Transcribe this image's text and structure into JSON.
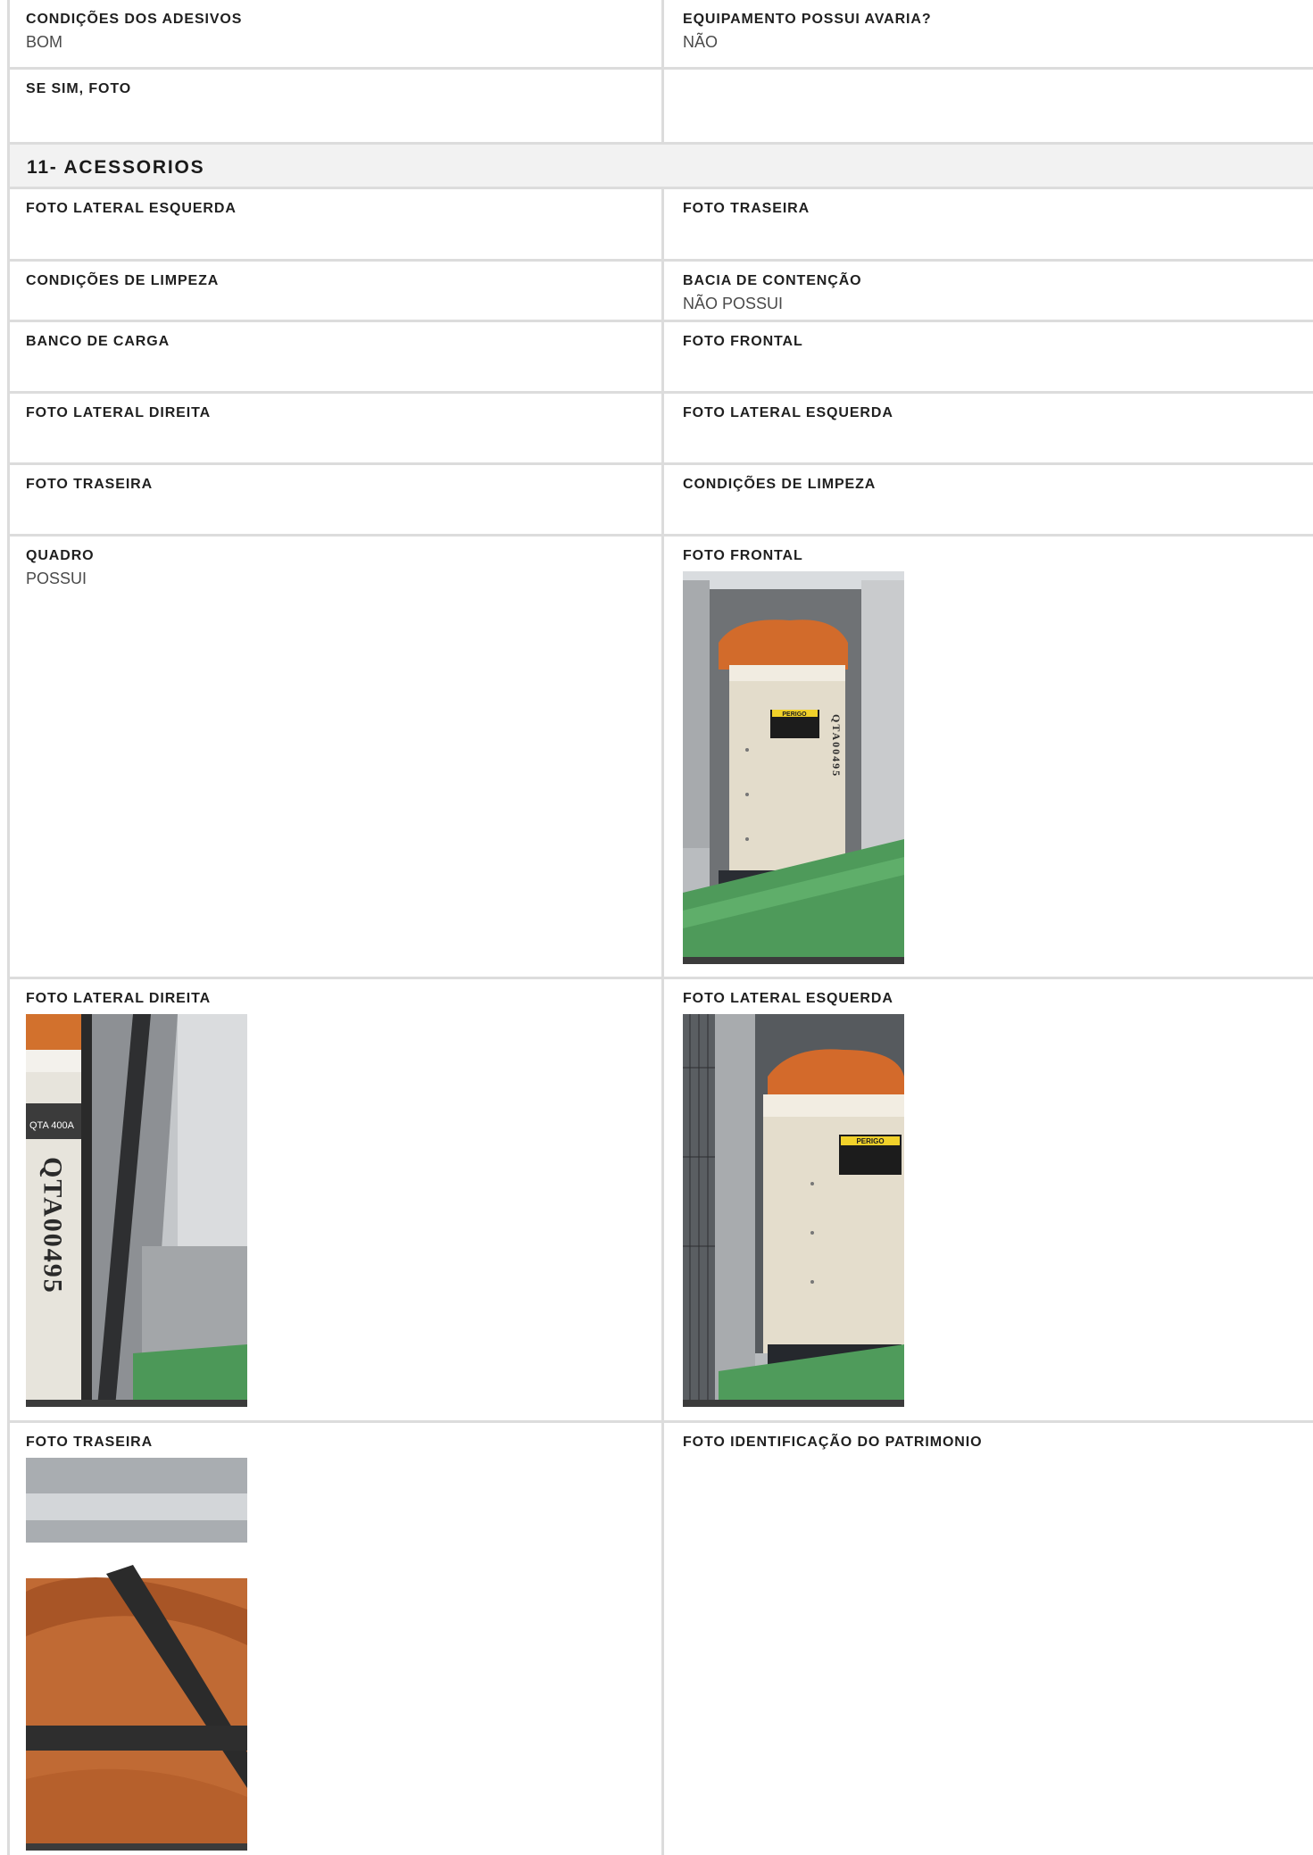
{
  "top_rows": [
    {
      "left": {
        "label": "CONDIÇÕES DOS ADESIVOS",
        "value": "BOM"
      },
      "right": {
        "label": "EQUIPAMENTO POSSUI AVARIA?",
        "value": "NÃO"
      }
    },
    {
      "left": {
        "label": "SE SIM, FOTO",
        "value": ""
      },
      "right": {
        "label": "",
        "value": ""
      }
    }
  ],
  "section": {
    "title": "11- ACESSORIOS"
  },
  "rows": [
    {
      "left": {
        "label": "FOTO LATERAL ESQUERDA",
        "value": ""
      },
      "right": {
        "label": "FOTO TRASEIRA",
        "value": ""
      }
    },
    {
      "left": {
        "label": "CONDIÇÕES DE LIMPEZA",
        "value": ""
      },
      "right": {
        "label": "BACIA DE CONTENÇÃO",
        "value": "NÃO POSSUI"
      }
    },
    {
      "left": {
        "label": "BANCO DE CARGA",
        "value": ""
      },
      "right": {
        "label": "FOTO FRONTAL",
        "value": ""
      }
    },
    {
      "left": {
        "label": "FOTO LATERAL DIREITA",
        "value": ""
      },
      "right": {
        "label": "FOTO LATERAL ESQUERDA",
        "value": ""
      }
    },
    {
      "left": {
        "label": "FOTO TRASEIRA",
        "value": ""
      },
      "right": {
        "label": "CONDIÇÕES DE LIMPEZA",
        "value": ""
      }
    },
    {
      "left": {
        "label": "QUADRO",
        "value": "POSSUI"
      },
      "right": {
        "label": "FOTO FRONTAL",
        "value": ""
      }
    },
    {
      "left": {
        "label": "FOTO LATERAL DIREITA",
        "value": ""
      },
      "right": {
        "label": "FOTO LATERAL ESQUERDA",
        "value": ""
      }
    },
    {
      "left": {
        "label": "FOTO TRASEIRA",
        "value": ""
      },
      "right": {
        "label": "FOTO IDENTIFICAÇÃO DO PATRIMONIO",
        "value": ""
      }
    }
  ],
  "photos": {
    "front": {
      "cabinet_code": "QTA00495",
      "warning": "PERIGO"
    },
    "right_side": {
      "cabinet_model": "QTA 400A",
      "cabinet_code": "QTA00495"
    },
    "left_side": {
      "warning": "PERIGO"
    },
    "back": {}
  }
}
